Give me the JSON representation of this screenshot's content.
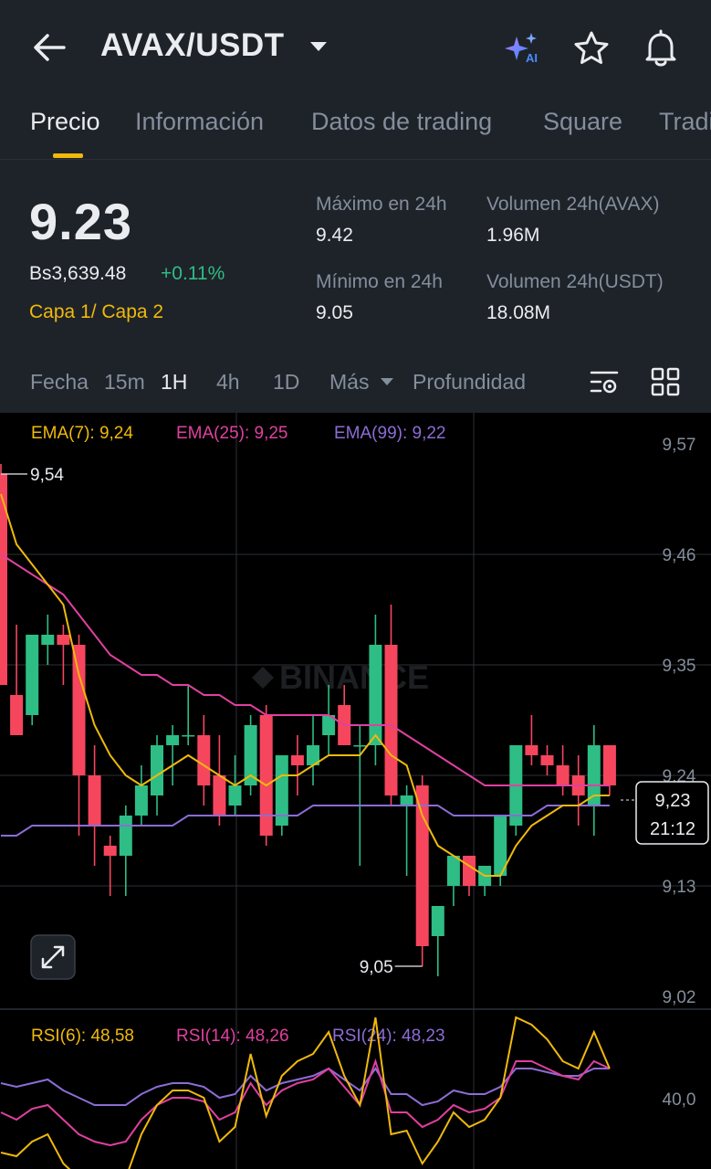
{
  "header": {
    "pair": "AVAX/USDT",
    "back_icon": "arrow-left-icon",
    "ai_icon": "ai-sparkle-icon",
    "ai_label": "AI",
    "favorite_icon": "star-icon",
    "alert_icon": "bell-icon"
  },
  "tabs": [
    "Precio",
    "Información",
    "Datos de trading",
    "Square",
    "Trading"
  ],
  "active_tab": "Precio",
  "ticker": {
    "last_price": "9.23",
    "fiat_price": "Bs3,639.48",
    "change": "+0.11%",
    "tag": "Capa 1/ Capa 2",
    "stats": [
      {
        "label": "Máximo en 24h",
        "value": "9.42"
      },
      {
        "label": "Volumen 24h(AVAX)",
        "value": "1.96M"
      },
      {
        "label": "Mínimo en 24h",
        "value": "9.05"
      },
      {
        "label": "Volumen 24h(USDT)",
        "value": "18.08M"
      }
    ]
  },
  "toolbar": {
    "items": [
      "Fecha",
      "15m",
      "1H",
      "4h",
      "1D",
      "Más",
      "Profundidad"
    ],
    "active": "1H",
    "settings_icon": "chart-settings-icon",
    "layout_icon": "grid-layout-icon"
  },
  "colors": {
    "up": "#2ebd85",
    "down": "#f6465d",
    "ema7": "#f0b90b",
    "ema25": "#e040a0",
    "ema99": "#8c6cd6",
    "accent": "#f0b90b"
  },
  "chart_data": {
    "type": "candlestick",
    "interval": "1H",
    "watermark": "BINANCE",
    "y_ticks": [
      "9,57",
      "9,46",
      "9,35",
      "9,24",
      "9,13",
      "9,02"
    ],
    "ylim": [
      9.02,
      9.57
    ],
    "ema_labels": {
      "ema7": "EMA(7): 9,24",
      "ema25": "EMA(25): 9,25",
      "ema99": "EMA(99): 9,22"
    },
    "high_marker": "9,54",
    "low_marker": "9,05",
    "current_price_label": "9,23",
    "countdown": "21:12",
    "candles": [
      {
        "o": 9.54,
        "h": 9.55,
        "l": 9.33,
        "c": 9.33
      },
      {
        "o": 9.32,
        "h": 9.39,
        "l": 9.28,
        "c": 9.28
      },
      {
        "o": 9.3,
        "h": 9.38,
        "l": 9.29,
        "c": 9.38
      },
      {
        "o": 9.37,
        "h": 9.4,
        "l": 9.35,
        "c": 9.38
      },
      {
        "o": 9.38,
        "h": 9.39,
        "l": 9.33,
        "c": 9.37
      },
      {
        "o": 9.37,
        "h": 9.38,
        "l": 9.18,
        "c": 9.24
      },
      {
        "o": 9.24,
        "h": 9.27,
        "l": 9.15,
        "c": 9.19
      },
      {
        "o": 9.17,
        "h": 9.18,
        "l": 9.12,
        "c": 9.16
      },
      {
        "o": 9.16,
        "h": 9.21,
        "l": 9.12,
        "c": 9.2
      },
      {
        "o": 9.2,
        "h": 9.25,
        "l": 9.19,
        "c": 9.23
      },
      {
        "o": 9.22,
        "h": 9.28,
        "l": 9.2,
        "c": 9.27
      },
      {
        "o": 9.27,
        "h": 9.29,
        "l": 9.23,
        "c": 9.28
      },
      {
        "o": 9.28,
        "h": 9.33,
        "l": 9.27,
        "c": 9.28
      },
      {
        "o": 9.28,
        "h": 9.3,
        "l": 9.21,
        "c": 9.23
      },
      {
        "o": 9.24,
        "h": 9.28,
        "l": 9.19,
        "c": 9.2
      },
      {
        "o": 9.21,
        "h": 9.26,
        "l": 9.2,
        "c": 9.23
      },
      {
        "o": 9.23,
        "h": 9.3,
        "l": 9.22,
        "c": 9.29
      },
      {
        "o": 9.3,
        "h": 9.31,
        "l": 9.17,
        "c": 9.18
      },
      {
        "o": 9.19,
        "h": 9.25,
        "l": 9.18,
        "c": 9.26
      },
      {
        "o": 9.26,
        "h": 9.28,
        "l": 9.22,
        "c": 9.25
      },
      {
        "o": 9.25,
        "h": 9.3,
        "l": 9.23,
        "c": 9.27
      },
      {
        "o": 9.28,
        "h": 9.33,
        "l": 9.26,
        "c": 9.3
      },
      {
        "o": 9.31,
        "h": 9.33,
        "l": 9.27,
        "c": 9.27
      },
      {
        "o": 9.27,
        "h": 9.29,
        "l": 9.15,
        "c": 9.27
      },
      {
        "o": 9.27,
        "h": 9.4,
        "l": 9.25,
        "c": 9.37
      },
      {
        "o": 9.37,
        "h": 9.41,
        "l": 9.21,
        "c": 9.22
      },
      {
        "o": 9.21,
        "h": 9.23,
        "l": 9.14,
        "c": 9.22
      },
      {
        "o": 9.23,
        "h": 9.24,
        "l": 9.05,
        "c": 9.07
      },
      {
        "o": 9.08,
        "h": 9.11,
        "l": 9.04,
        "c": 9.11
      },
      {
        "o": 9.13,
        "h": 9.16,
        "l": 9.11,
        "c": 9.16
      },
      {
        "o": 9.16,
        "h": 9.16,
        "l": 9.12,
        "c": 9.13
      },
      {
        "o": 9.13,
        "h": 9.15,
        "l": 9.12,
        "c": 9.15
      },
      {
        "o": 9.14,
        "h": 9.2,
        "l": 9.13,
        "c": 9.2
      },
      {
        "o": 9.19,
        "h": 9.27,
        "l": 9.18,
        "c": 9.27
      },
      {
        "o": 9.27,
        "h": 9.3,
        "l": 9.25,
        "c": 9.26
      },
      {
        "o": 9.26,
        "h": 9.27,
        "l": 9.24,
        "c": 9.25
      },
      {
        "o": 9.25,
        "h": 9.27,
        "l": 9.22,
        "c": 9.23
      },
      {
        "o": 9.24,
        "h": 9.26,
        "l": 9.19,
        "c": 9.22
      },
      {
        "o": 9.21,
        "h": 9.29,
        "l": 9.18,
        "c": 9.27
      },
      {
        "o": 9.27,
        "h": 9.27,
        "l": 9.22,
        "c": 9.23
      }
    ],
    "ema7": [
      9.52,
      9.47,
      9.45,
      9.43,
      9.41,
      9.34,
      9.29,
      9.26,
      9.24,
      9.23,
      9.24,
      9.25,
      9.26,
      9.25,
      9.24,
      9.23,
      9.24,
      9.23,
      9.24,
      9.24,
      9.25,
      9.26,
      9.26,
      9.26,
      9.28,
      9.26,
      9.25,
      9.2,
      9.17,
      9.16,
      9.15,
      9.14,
      9.14,
      9.17,
      9.19,
      9.2,
      9.21,
      9.21,
      9.22,
      9.22
    ],
    "ema25": [
      9.46,
      9.45,
      9.44,
      9.43,
      9.42,
      9.4,
      9.38,
      9.36,
      9.35,
      9.34,
      9.34,
      9.33,
      9.33,
      9.32,
      9.32,
      9.31,
      9.31,
      9.3,
      9.3,
      9.3,
      9.3,
      9.3,
      9.29,
      9.29,
      9.29,
      9.29,
      9.28,
      9.27,
      9.26,
      9.25,
      9.24,
      9.23,
      9.23,
      9.23,
      9.23,
      9.23,
      9.23,
      9.23,
      9.23,
      9.23
    ],
    "ema99": [
      9.18,
      9.18,
      9.19,
      9.19,
      9.19,
      9.19,
      9.19,
      9.19,
      9.19,
      9.19,
      9.19,
      9.19,
      9.2,
      9.2,
      9.2,
      9.2,
      9.2,
      9.2,
      9.2,
      9.2,
      9.21,
      9.21,
      9.21,
      9.21,
      9.21,
      9.21,
      9.21,
      9.21,
      9.21,
      9.2,
      9.2,
      9.2,
      9.2,
      9.2,
      9.2,
      9.21,
      9.21,
      9.21,
      9.21,
      9.21
    ],
    "rsi": {
      "labels": {
        "rsi6": "RSI(6): 48,58",
        "rsi14": "RSI(14): 48,26",
        "rsi24": "RSI(24): 48,23"
      },
      "y_tick": "40,0",
      "rsi6": [
        25,
        24,
        28,
        30,
        22,
        18,
        16,
        15,
        18,
        30,
        38,
        42,
        42,
        40,
        28,
        32,
        52,
        35,
        46,
        50,
        52,
        58,
        46,
        38,
        62,
        30,
        31,
        22,
        28,
        36,
        32,
        34,
        40,
        62,
        60,
        56,
        50,
        48,
        58,
        48
      ],
      "rsi14": [
        36,
        34,
        37,
        38,
        34,
        30,
        28,
        27,
        28,
        34,
        38,
        40,
        40,
        39,
        34,
        36,
        44,
        38,
        42,
        44,
        45,
        48,
        43,
        38,
        50,
        36,
        36,
        32,
        34,
        38,
        36,
        37,
        40,
        50,
        50,
        48,
        46,
        45,
        50,
        48
      ],
      "rsi24": [
        44,
        43,
        44,
        45,
        42,
        40,
        38,
        38,
        38,
        41,
        43,
        44,
        44,
        43,
        40,
        41,
        46,
        42,
        44,
        45,
        46,
        48,
        45,
        42,
        48,
        41,
        41,
        38,
        39,
        42,
        41,
        41,
        43,
        48,
        48,
        47,
        46,
        46,
        48,
        48
      ]
    }
  }
}
